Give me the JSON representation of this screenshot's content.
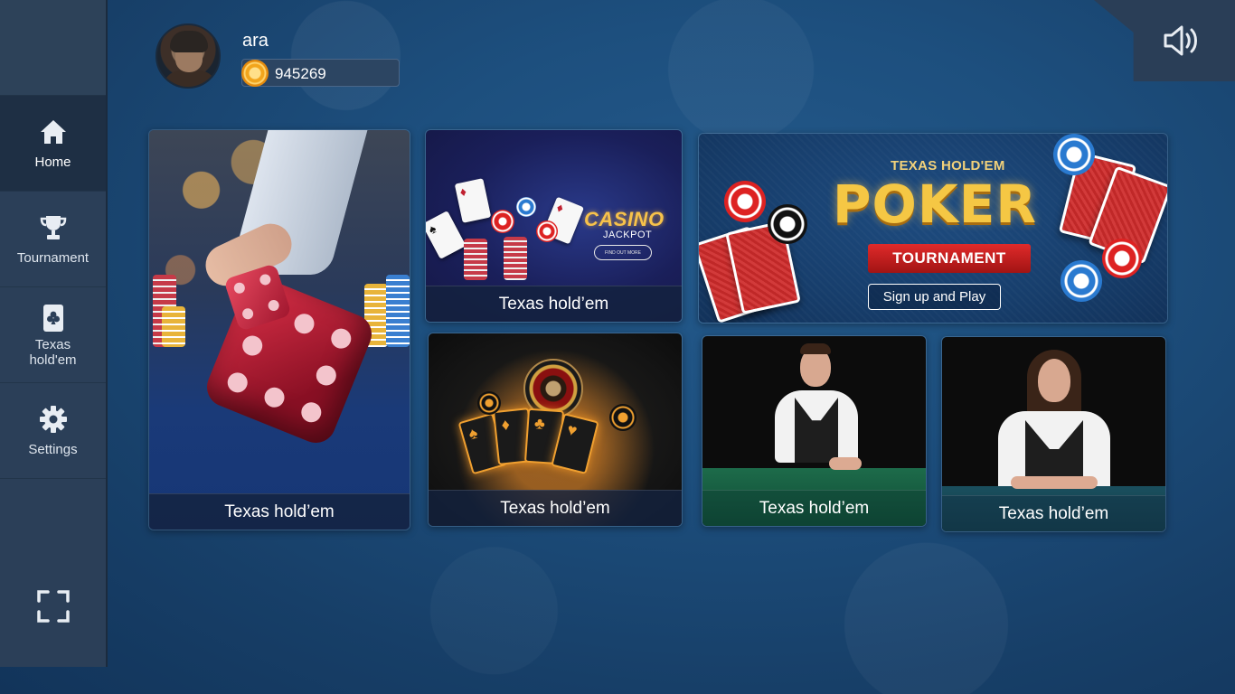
{
  "user": {
    "name": "ara",
    "coins": "945269"
  },
  "sidebar": {
    "items": [
      {
        "label": "Home",
        "icon": "home-icon",
        "active": true
      },
      {
        "label": "Tournament",
        "icon": "trophy-icon",
        "active": false
      },
      {
        "label": "Texas\nhold'em",
        "icon": "card-club-icon",
        "active": false
      },
      {
        "label": "Settings",
        "icon": "gear-icon",
        "active": false
      }
    ],
    "fullscreen_icon": "fullscreen-icon"
  },
  "header": {
    "sound_icon": "speaker-icon"
  },
  "cards": [
    {
      "id": "dice",
      "caption": "Texas hold’em"
    },
    {
      "id": "casino",
      "caption": "Texas hold’em",
      "art_title": "CASINO",
      "art_subtitle": "JACKPOT",
      "art_button": "FIND OUT MORE"
    },
    {
      "id": "poker-tournament",
      "art_top": "TEXAS HOLD'EM",
      "art_title": "POKER",
      "art_ribbon": "TOURNAMENT",
      "art_button": "Sign up and Play"
    },
    {
      "id": "aces",
      "caption": "Texas hold’em"
    },
    {
      "id": "dealer-male",
      "caption": "Texas hold’em"
    },
    {
      "id": "dealer-female",
      "caption": "Texas hold’em"
    }
  ],
  "colors": {
    "background": "#1d4f7e",
    "sidebar": "#2b3f58",
    "sidebar_active": "#1e2f44",
    "caption_bg": "#14223e",
    "gold": "#f5c744",
    "ribbon_red": "#e02a2a"
  }
}
